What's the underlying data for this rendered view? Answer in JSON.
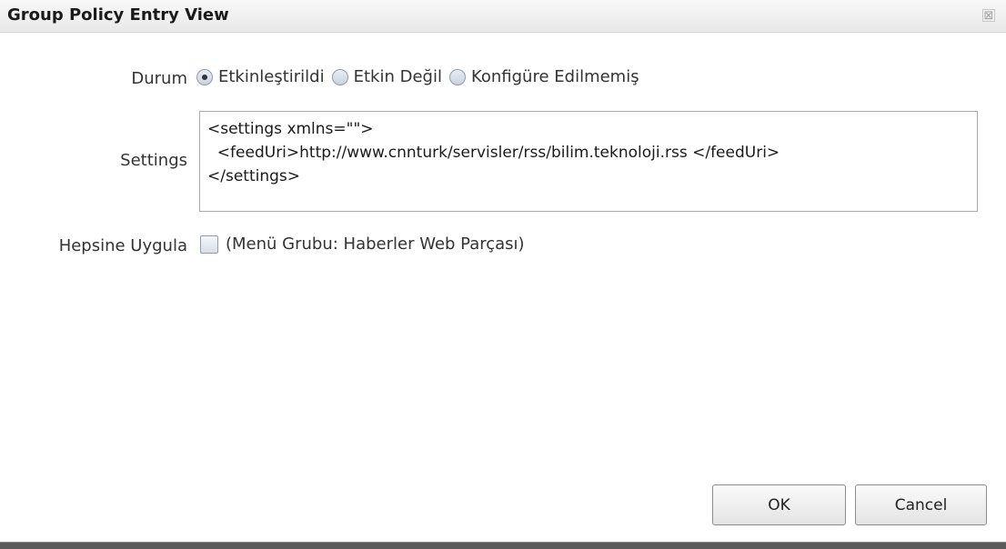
{
  "window": {
    "title": "Group Policy Entry View",
    "close_glyph": "⊠"
  },
  "form": {
    "status_label": "Durum",
    "status_options": [
      {
        "label": "Etkinleştirildi",
        "checked": true
      },
      {
        "label": "Etkin Değil",
        "checked": false
      },
      {
        "label": "Konfigüre Edilmemiş",
        "checked": false
      }
    ],
    "settings_label": "Settings",
    "settings_value": "<settings xmlns=\"\">\n  <feedUri>http://www.cnnturk/servisler/rss/bilim.teknoloji.rss </feedUri>\n</settings>",
    "apply_label": "Hepsine Uygula",
    "apply_checked": false,
    "apply_text": "(Menü Grubu: Haberler Web Parçası)"
  },
  "buttons": {
    "ok": "OK",
    "cancel": "Cancel"
  }
}
